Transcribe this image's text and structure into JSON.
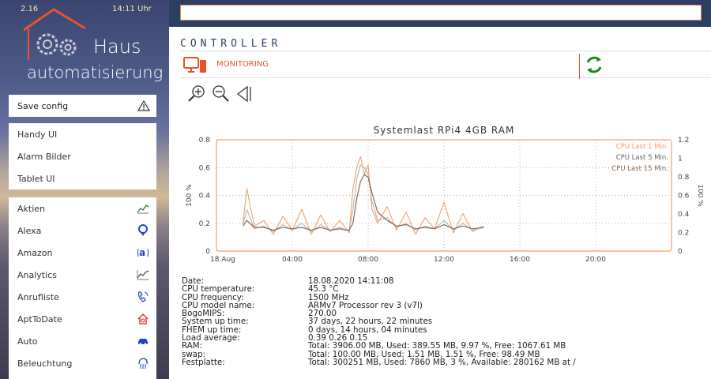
{
  "header": {
    "version": "2.16",
    "time": "14:11 Uhr",
    "logo_line1": "Haus",
    "logo_line2": "automatisierung"
  },
  "sidebar": {
    "save_label": "Save config",
    "group1": [
      {
        "label": "Handy UI"
      },
      {
        "label": "Alarm Bilder"
      },
      {
        "label": "Tablet UI"
      }
    ],
    "group2": [
      {
        "label": "Aktien",
        "icon": "chart-line-icon"
      },
      {
        "label": "Alexa",
        "icon": "location-pin-icon"
      },
      {
        "label": "Amazon",
        "icon": "amazon-icon"
      },
      {
        "label": "Analytics",
        "icon": "analytics-chart-icon"
      },
      {
        "label": "Anrufliste",
        "icon": "phone-call-icon"
      },
      {
        "label": "AptToDate",
        "icon": "home-update-icon"
      },
      {
        "label": "Auto",
        "icon": "car-icon"
      },
      {
        "label": "Beleuchtung",
        "icon": "lamp-icon"
      }
    ]
  },
  "main": {
    "section_title": "CONTROLLER",
    "monitoring_label": "MONITORING"
  },
  "colors": {
    "accent": "#e5542a",
    "navy": "#2b3e60",
    "chart_border": "#f0a070",
    "series1": "#f4a06a",
    "series2": "#bfbfbf",
    "series3": "#8a6a55"
  },
  "chart_data": {
    "type": "line",
    "title": "Systemlast RPi4 4GB RAM",
    "ylabel_left": "100 %",
    "ylabel_right": "100 %",
    "ylim_left": [
      0,
      0.8
    ],
    "ylim_right": [
      0,
      1.2
    ],
    "yticks_left": [
      "0",
      "0.2",
      "0.4",
      "0.6",
      "0.8"
    ],
    "yticks_right": [
      "0",
      "0.2",
      "0.4",
      "0.6",
      "0.8",
      "1",
      "1.2"
    ],
    "xticks": [
      "18.Aug",
      "04:00",
      "08:00",
      "12:00",
      "16:00",
      "20:00"
    ],
    "xtick_hours": [
      0,
      4,
      8,
      12,
      16,
      20
    ],
    "xlim_hours": [
      0,
      24
    ],
    "legend_position": "top-right",
    "grid": true,
    "series": [
      {
        "name": "CPU Last 1 Min.",
        "x": [
          1.4,
          1.6,
          2,
          2.5,
          3,
          3.5,
          4,
          4.5,
          5,
          5.5,
          6,
          6.5,
          7,
          7.2,
          7.4,
          7.6,
          7.8,
          8,
          8.2,
          8.5,
          9,
          9.5,
          10,
          10.5,
          11,
          11.5,
          12,
          12.5,
          13,
          13.5,
          14.1
        ],
        "y": [
          0.2,
          0.45,
          0.18,
          0.22,
          0.12,
          0.25,
          0.15,
          0.3,
          0.12,
          0.26,
          0.14,
          0.22,
          0.13,
          0.45,
          0.6,
          0.68,
          0.55,
          0.62,
          0.3,
          0.2,
          0.32,
          0.15,
          0.28,
          0.12,
          0.24,
          0.16,
          0.35,
          0.13,
          0.27,
          0.14,
          0.18
        ]
      },
      {
        "name": "CPU Last 5 Min.",
        "x": [
          1.4,
          1.6,
          2,
          2.5,
          3,
          3.5,
          4,
          4.5,
          5,
          5.5,
          6,
          6.5,
          7,
          7.2,
          7.4,
          7.6,
          7.8,
          8,
          8.2,
          8.5,
          9,
          9.5,
          10,
          10.5,
          11,
          11.5,
          12,
          12.5,
          13,
          13.5,
          14.1
        ],
        "y": [
          0.19,
          0.3,
          0.16,
          0.18,
          0.14,
          0.19,
          0.15,
          0.2,
          0.14,
          0.19,
          0.15,
          0.17,
          0.14,
          0.3,
          0.52,
          0.62,
          0.6,
          0.55,
          0.36,
          0.22,
          0.24,
          0.17,
          0.2,
          0.15,
          0.18,
          0.16,
          0.22,
          0.15,
          0.2,
          0.15,
          0.17
        ]
      },
      {
        "name": "CPU Last 15 Min.",
        "x": [
          1.4,
          1.6,
          2,
          2.5,
          3,
          3.5,
          4,
          4.5,
          5,
          5.5,
          6,
          6.5,
          7,
          7.2,
          7.4,
          7.6,
          7.8,
          8,
          8.2,
          8.5,
          9,
          9.5,
          10,
          10.5,
          11,
          11.5,
          12,
          12.5,
          13,
          13.5,
          14.1
        ],
        "y": [
          0.18,
          0.22,
          0.17,
          0.17,
          0.15,
          0.17,
          0.16,
          0.17,
          0.15,
          0.17,
          0.15,
          0.16,
          0.15,
          0.2,
          0.38,
          0.5,
          0.55,
          0.53,
          0.42,
          0.28,
          0.22,
          0.18,
          0.19,
          0.16,
          0.17,
          0.16,
          0.19,
          0.16,
          0.18,
          0.16,
          0.17
        ]
      }
    ]
  },
  "details": [
    {
      "k": "Date:",
      "v": "18.08.2020 14:11:08"
    },
    {
      "k": "CPU temperature:",
      "v": "45.3 °C"
    },
    {
      "k": "CPU frequency:",
      "v": "1500 MHz"
    },
    {
      "k": "CPU model name:",
      "v": "ARMv7 Processor rev 3 (v7l)"
    },
    {
      "k": "BogoMIPS:",
      "v": "270.00"
    },
    {
      "k": "System up time:",
      "v": "37 days, 22 hours, 22 minutes"
    },
    {
      "k": "FHEM up time:",
      "v": "0 days, 14 hours, 04 minutes"
    },
    {
      "k": "Load average:",
      "v": "0.39 0.26 0.15"
    },
    {
      "k": "RAM:",
      "v": "Total: 3906.00 MB, Used: 389.55 MB, 9.97 %, Free: 1067.61 MB"
    },
    {
      "k": "swap:",
      "v": "Total: 100.00 MB, Used: 1.51 MB, 1.51 %, Free: 98.49 MB"
    },
    {
      "k": "Festplatte:",
      "v": "Total: 300251 MB, Used: 7860 MB, 3 %, Available: 280162 MB at /"
    }
  ]
}
